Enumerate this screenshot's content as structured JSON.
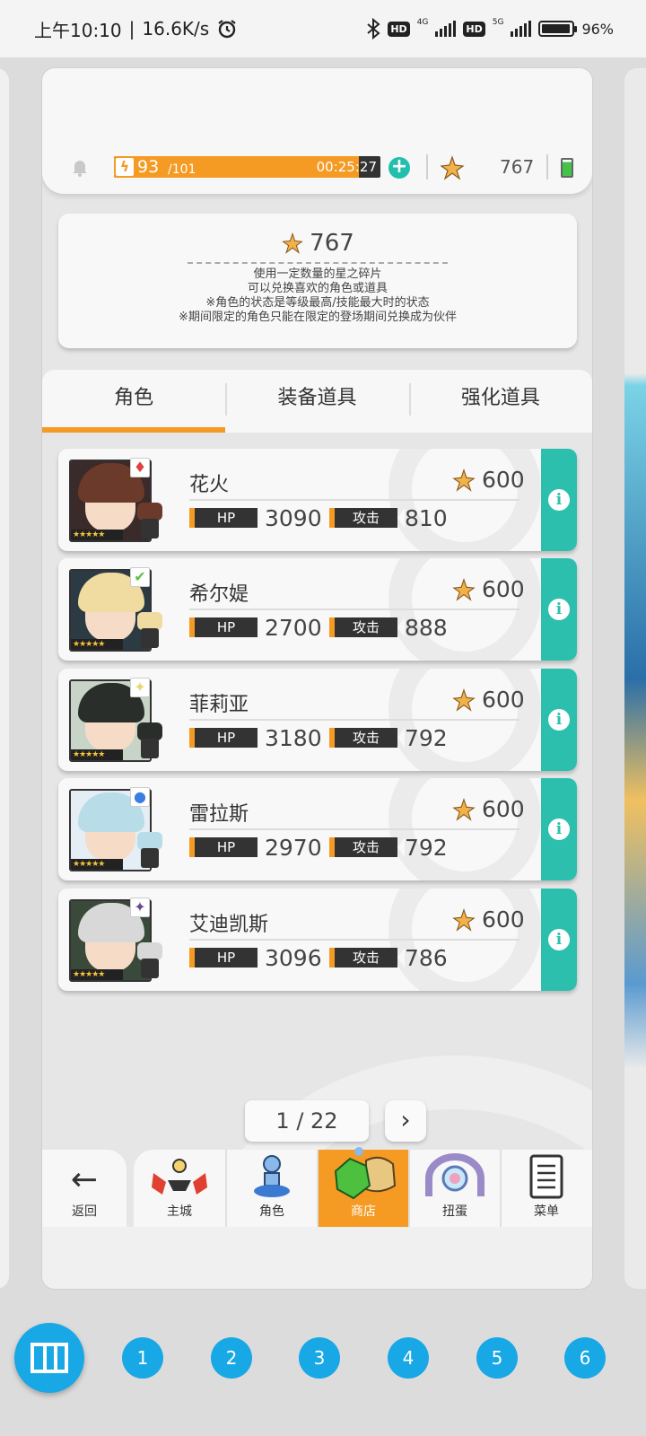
{
  "status_bar": {
    "time": "上午10:10",
    "speed": "16.6K/s",
    "hd_badge": "HD",
    "net_4g": "4G",
    "net_5g": "5G",
    "battery": "96%",
    "battery_level": 0.96
  },
  "header": {
    "stamina_current": "93",
    "stamina_max": "/101",
    "stamina_fraction": 0.92,
    "stamina_timer": "00:25:27",
    "shard_count": "767"
  },
  "info": {
    "shard_amount": "767",
    "lines": [
      "使用一定数量的星之碎片",
      "可以兑换喜欢的角色或道具",
      "※角色的状态是等级最高/技能最大时的状态",
      "※期间限定的角色只能在限定的登场期间兑换成为伙伴"
    ]
  },
  "tabs": [
    {
      "label": "角色",
      "active": true
    },
    {
      "label": "装备道具",
      "active": false
    },
    {
      "label": "强化道具",
      "active": false
    }
  ],
  "stat_labels": {
    "hp": "HP",
    "atk": "攻击"
  },
  "characters": [
    {
      "name": "花火",
      "hp": "3090",
      "atk": "810",
      "price": "600",
      "element": "♦",
      "element_color": "#e04040",
      "hair": "#6b3a2a",
      "bg": "#3a2a2a"
    },
    {
      "name": "希尔媞",
      "hp": "2700",
      "atk": "888",
      "price": "600",
      "element": "✔",
      "element_color": "#5cc04a",
      "hair": "#f0dca0",
      "bg": "#2c3a44"
    },
    {
      "name": "菲莉亚",
      "hp": "3180",
      "atk": "792",
      "price": "600",
      "element": "✦",
      "element_color": "#e8d870",
      "hair": "#2a2e2a",
      "bg": "#c8d4c8"
    },
    {
      "name": "雷拉斯",
      "hp": "2970",
      "atk": "792",
      "price": "600",
      "element": "●",
      "element_color": "#3a7fe0",
      "hair": "#b8dce8",
      "bg": "#e4eef4"
    },
    {
      "name": "艾迪凯斯",
      "hp": "3096",
      "atk": "786",
      "price": "600",
      "element": "✦",
      "element_color": "#6a4a8a",
      "hair": "#d8d8d8",
      "bg": "#3a4a3a"
    }
  ],
  "stars": "★★★★★",
  "pager": {
    "text": "1 / 22",
    "next": "›"
  },
  "nav": {
    "back_label": "返回",
    "back_arrow": "←",
    "items": [
      {
        "label": "主城",
        "icon": "castle-icon",
        "active": false
      },
      {
        "label": "角色",
        "icon": "character-icon",
        "active": false
      },
      {
        "label": "商店",
        "icon": "shop-bag-icon",
        "active": true
      },
      {
        "label": "扭蛋",
        "icon": "gacha-icon",
        "active": false
      },
      {
        "label": "菜单",
        "icon": "menu-list-icon",
        "active": false
      }
    ]
  },
  "dock": {
    "pages": [
      "1",
      "2",
      "3",
      "4",
      "5",
      "6"
    ]
  },
  "colors": {
    "accent": "#f59a23",
    "teal": "#2dbfae",
    "dock_blue": "#18a8e6"
  }
}
